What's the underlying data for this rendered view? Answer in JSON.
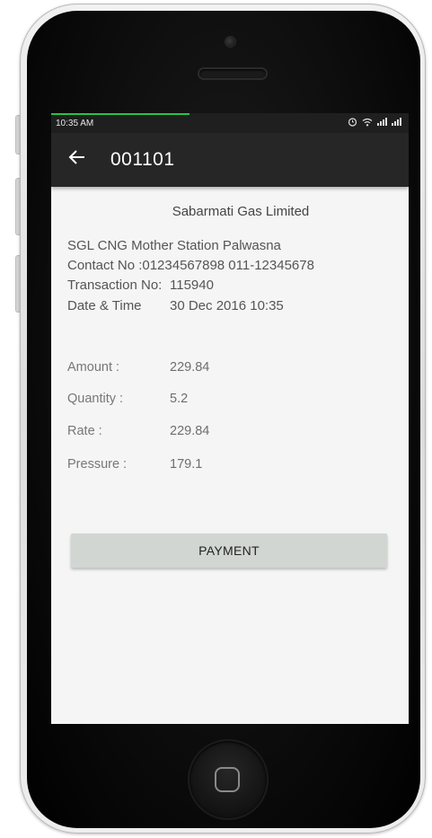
{
  "status_bar": {
    "time": "10:35 AM"
  },
  "app_bar": {
    "back_icon": "arrow-left-icon",
    "title": "001101"
  },
  "receipt": {
    "company": "Sabarmati Gas Limited",
    "station": "SGL CNG Mother Station Palwasna",
    "contact": "Contact No :01234567898   011-12345678",
    "transaction_label": "Transaction No:",
    "transaction_value": "115940",
    "datetime_label": "Date & Time",
    "datetime_value": "30 Dec 2016 10:35"
  },
  "fields": [
    {
      "label": "Amount :",
      "value": "229.84"
    },
    {
      "label": "Quantity :",
      "value": "5.2"
    },
    {
      "label": "Rate :",
      "value": "229.84"
    },
    {
      "label": "Pressure :",
      "value": "179.1"
    }
  ],
  "actions": {
    "payment_label": "PAYMENT"
  },
  "colors": {
    "app_bar": "#262626",
    "accent_progress": "#27c24c",
    "button": "#d2d6d2"
  }
}
